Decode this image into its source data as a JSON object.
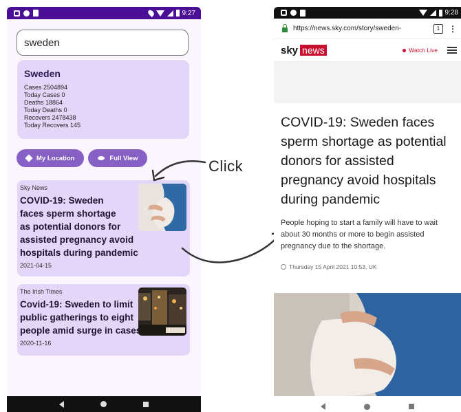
{
  "left_phone": {
    "status_bar": {
      "time": "9:27"
    },
    "search": {
      "value": "sweden"
    },
    "stats": {
      "country": "Sweden",
      "lines": [
        "Cases 2504894",
        "Today Cases 0",
        "Deaths 18864",
        "Today Deaths 0",
        "Recovers 2478438",
        "Today Recovers  145"
      ]
    },
    "buttons": {
      "my_location": {
        "label": "My Location",
        "icon": "location-icon"
      },
      "full_view": {
        "label": "Full View",
        "icon": "eye-icon"
      }
    },
    "news": [
      {
        "source": "Sky News",
        "title_lines": [
          "COVID-19: Sweden",
          "faces sperm shortage",
          "as potential donors for",
          "assisted pregnancy avoid",
          "hospitals during pandemic"
        ],
        "date": "2021-04-15"
      },
      {
        "source": "The Irish Times",
        "title_lines": [
          "Covid-19: Sweden to limit",
          "public gatherings to eight",
          "people amid surge in cases"
        ],
        "date": "2020-11-16"
      }
    ]
  },
  "annotation": {
    "click_label": "Click"
  },
  "right_phone": {
    "status_bar": {
      "time": "9:28"
    },
    "browser": {
      "url_main": "https://news.sky.com/story/sweden-",
      "tab_count": "1"
    },
    "site": {
      "logo_sky": "sky",
      "logo_news": "news",
      "watch_live": "Watch Live"
    },
    "article": {
      "title": "COVID-19: Sweden faces sperm shortage as potential donors for assisted pregnancy avoid hospitals during pandemic",
      "subtitle": "People hoping to start a family will have to wait about 30 months or more to begin assisted pregnancy due to the shortage.",
      "date": "Thursday 15 April 2021 10:53, UK"
    }
  },
  "colors": {
    "status_bar_purple": "#4a0f96",
    "card_lavender": "#e4d6f8",
    "button_purple": "#8660c4",
    "sky_red": "#c8102e"
  }
}
